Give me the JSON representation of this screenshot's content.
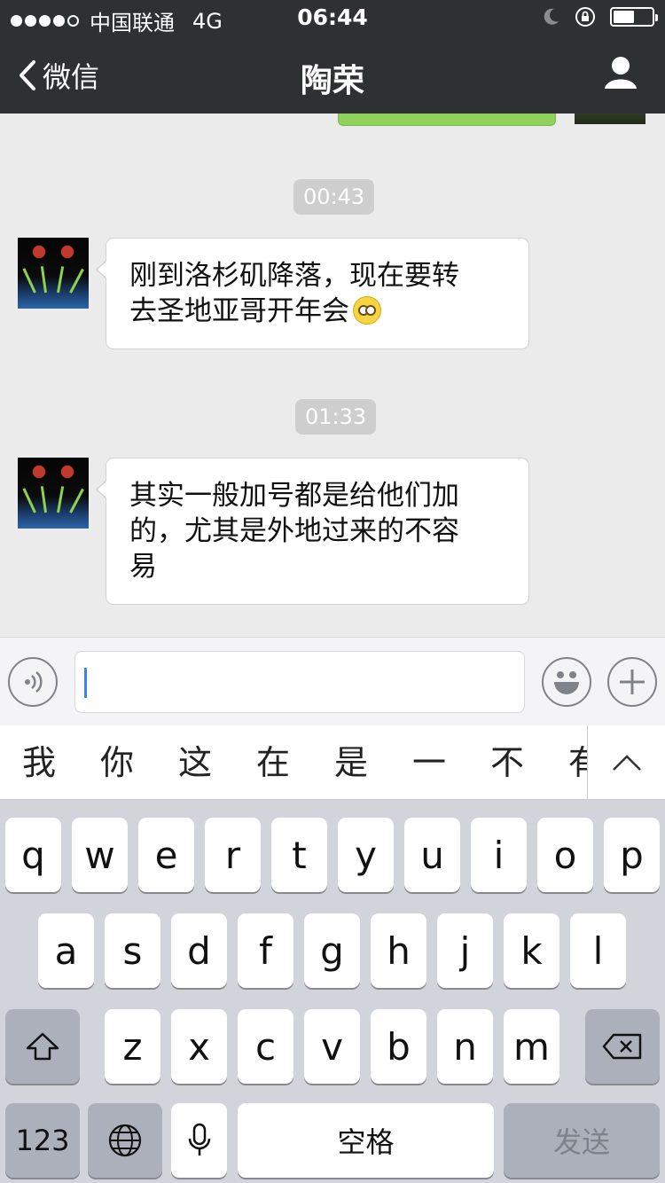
{
  "status_bar": {
    "carrier": "中国联通",
    "network": "4G",
    "time": "06:44",
    "battery_level": 0.55
  },
  "nav": {
    "back_label": "微信",
    "title": "陶荣",
    "icons": {
      "back": "chevron-left-icon",
      "profile": "person-icon"
    }
  },
  "messages": [
    {
      "timestamp": "00:43",
      "text_lines": [
        "刚到洛杉矶降落，现在要转",
        "去圣地亚哥开年会"
      ],
      "emoji": "smile-emoji"
    },
    {
      "timestamp": "01:33",
      "text_lines": [
        "其实一般加号都是给他们加",
        "的，尤其是外地过来的不容",
        "易"
      ]
    }
  ],
  "input_bar": {
    "value": "",
    "icons": {
      "voice": "voice-icon",
      "emoji": "emoji-face-icon",
      "more": "plus-icon"
    }
  },
  "candidates": [
    "我",
    "你",
    "这",
    "在",
    "是",
    "一",
    "不",
    "有"
  ],
  "keyboard": {
    "row1": [
      "q",
      "w",
      "e",
      "r",
      "t",
      "y",
      "u",
      "i",
      "o",
      "p"
    ],
    "row2": [
      "a",
      "s",
      "d",
      "f",
      "g",
      "h",
      "j",
      "k",
      "l"
    ],
    "row3": [
      "z",
      "x",
      "c",
      "v",
      "b",
      "n",
      "m"
    ],
    "num_label": "123",
    "space_label": "空格",
    "send_label": "发送"
  },
  "colors": {
    "nav_bg": "#2e3132",
    "chat_bg": "#ebebeb",
    "sent_bubble": "#8fd15a",
    "timestamp_bg": "#cecece",
    "caret": "#3b82f6"
  }
}
